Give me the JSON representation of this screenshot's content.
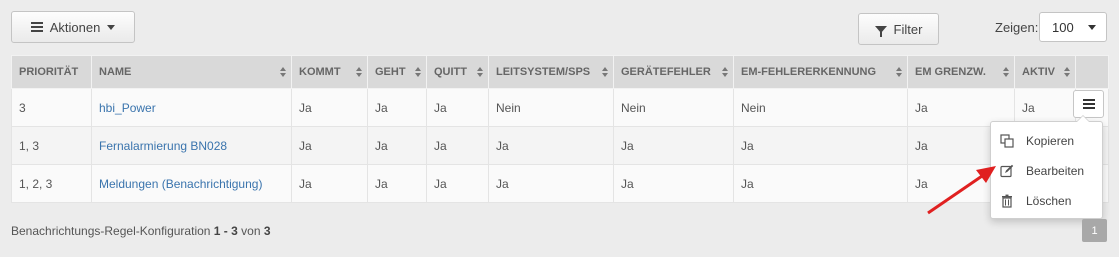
{
  "toolbar": {
    "actions_label": "Aktionen",
    "filter_label": "Filter",
    "show_label": "Zeigen:",
    "page_size": "100"
  },
  "table": {
    "columns": [
      "PRIORITÄT",
      "NAME",
      "KOMMT",
      "GEHT",
      "QUITT",
      "LEITSYSTEM/SPS",
      "GERÄTEFEHLER",
      "EM-FEHLERERKENNUNG",
      "EM GRENZW.",
      "AKTIV",
      ""
    ],
    "rows": [
      [
        "3",
        "hbi_Power",
        "Ja",
        "Ja",
        "Ja",
        "Nein",
        "Nein",
        "Nein",
        "Ja",
        "Ja"
      ],
      [
        "1, 3",
        "Fernalarmierung BN028",
        "Ja",
        "Ja",
        "Ja",
        "Ja",
        "Ja",
        "Ja",
        "Ja",
        ""
      ],
      [
        "1, 2, 3",
        "Meldungen (Benachrichtigung)",
        "Ja",
        "Ja",
        "Ja",
        "Ja",
        "Ja",
        "Ja",
        "Ja",
        ""
      ]
    ]
  },
  "row_menu": {
    "items": [
      {
        "label": "Kopieren",
        "icon": "copy-icon"
      },
      {
        "label": "Bearbeiten",
        "icon": "edit-icon"
      },
      {
        "label": "Löschen",
        "icon": "trash-icon"
      }
    ]
  },
  "footer": {
    "prefix": "Benachrichtungs-Regel-Konfiguration",
    "range": "1 - 3",
    "of": "von",
    "total": "3",
    "current_page": "1"
  },
  "colors": {
    "link": "#3a74ad",
    "arrow": "#e02020"
  }
}
